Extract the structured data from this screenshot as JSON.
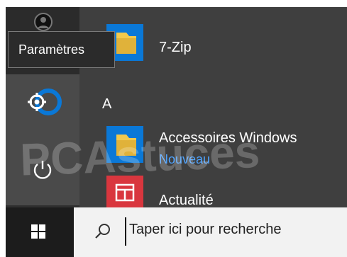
{
  "tooltip": {
    "label": "Paramètres"
  },
  "app_list": {
    "section_letter": "A",
    "items": [
      {
        "label": "7-Zip",
        "icon": "folder-icon"
      },
      {
        "label": "Accessoires Windows",
        "sublabel": "Nouveau",
        "icon": "folder-icon"
      },
      {
        "label": "Actualité",
        "icon": "news-icon"
      }
    ]
  },
  "taskbar": {
    "search_placeholder": "Taper ici pour recherche"
  },
  "watermark": {
    "text": "PCAstuces"
  },
  "colors": {
    "accent_blue": "#0a78d7",
    "folder_yellow": "#f2c94c",
    "news_red": "#d9363e",
    "link_blue": "#4ea3ff"
  }
}
